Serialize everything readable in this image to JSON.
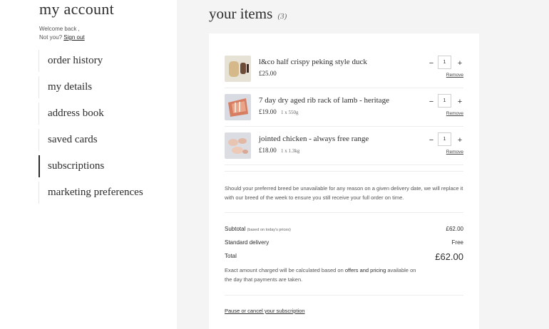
{
  "sidebar": {
    "title": "my account",
    "welcome": "Welcome back ,",
    "not_you": "Not you?",
    "sign_out": "Sign out",
    "nav": [
      {
        "label": "order history"
      },
      {
        "label": "my details"
      },
      {
        "label": "address book"
      },
      {
        "label": "saved cards"
      },
      {
        "label": "subscriptions"
      },
      {
        "label": "marketing preferences"
      }
    ],
    "active_item": "subscriptions"
  },
  "main": {
    "title": "your items",
    "count": "(3)",
    "items": [
      {
        "name": "l&co half crispy peking style duck",
        "price": "£25.00",
        "weight": "",
        "qty": "1",
        "remove": "Remove",
        "image": "duck-product-image"
      },
      {
        "name": "7 day dry aged rib rack of lamb - heritage",
        "price": "£19.00",
        "weight": "1 x 550g",
        "qty": "1",
        "remove": "Remove",
        "image": "lamb-product-image"
      },
      {
        "name": "jointed chicken - always free range",
        "price": "£18.00",
        "weight": "1 x 1.3kg",
        "qty": "1",
        "remove": "Remove",
        "image": "chicken-product-image"
      }
    ],
    "note": "Should your preferred breed be unavailable for any reason on a given delivery date, we will replace it with our breed of the week to ensure you still receive your full order on time.",
    "summary": {
      "subtotal_label": "Subtotal",
      "subtotal_note": "(based on today's prices)",
      "subtotal_value": "£62.00",
      "delivery_label": "Standard delivery",
      "delivery_value": "Free",
      "total_label": "Total",
      "total_value": "£62.00"
    },
    "exact_pre": "Exact amount charged will be calculated based on",
    "exact_link": "offers and pricing",
    "exact_post": "available on the day that payments are taken.",
    "pause_link": "Pause or cancel your subscription"
  },
  "icons": {
    "minus": "minus-icon",
    "plus": "plus-icon"
  }
}
